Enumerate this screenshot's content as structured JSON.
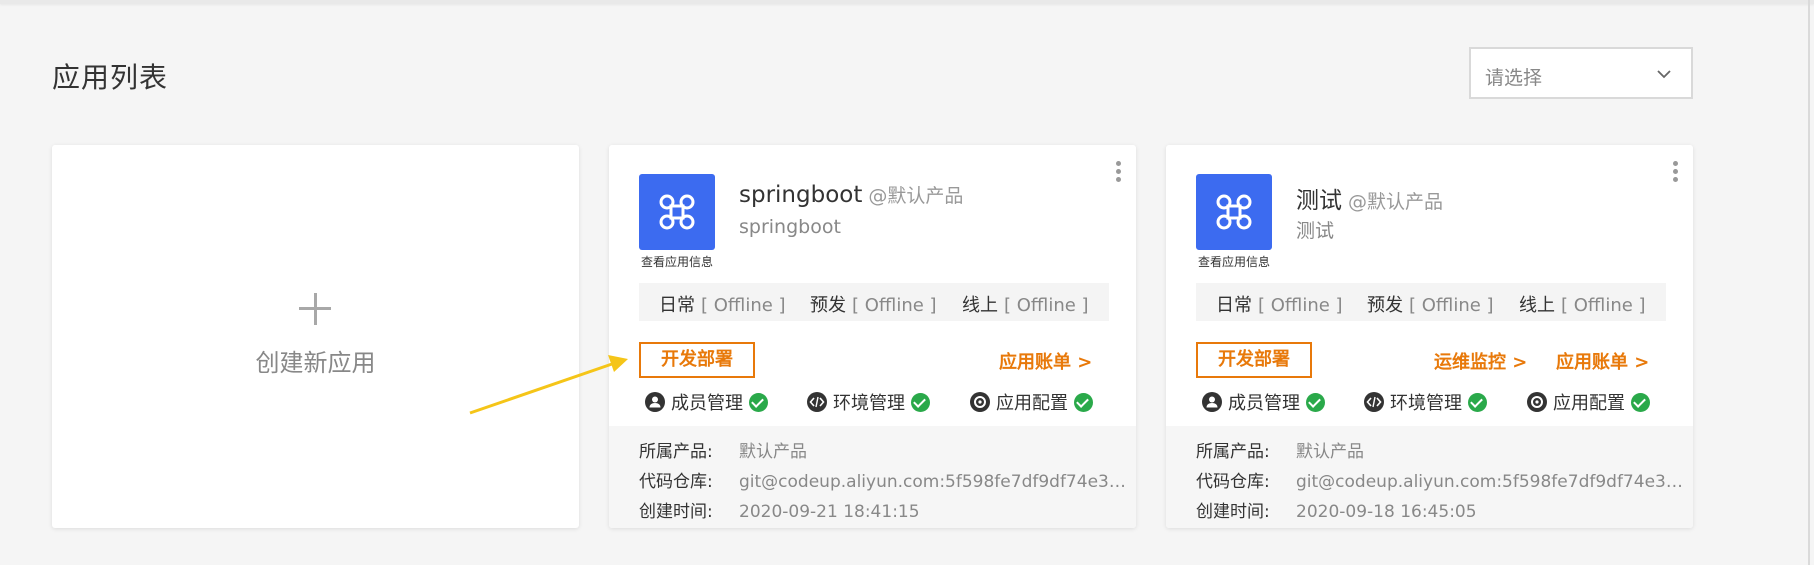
{
  "page": {
    "title": "应用列表"
  },
  "filter": {
    "placeholder": "请选择"
  },
  "create_card": {
    "label": "创建新应用"
  },
  "apps": [
    {
      "name": "springboot",
      "product_tag": "@默认产品",
      "description": "springboot",
      "view_info": "查看应用信息",
      "envs": [
        {
          "name": "日常",
          "status": "[ Offline ]"
        },
        {
          "name": "预发",
          "status": "[ Offline ]"
        },
        {
          "name": "线上",
          "status": "[ Offline ]"
        }
      ],
      "deploy_label": "开发部署",
      "links": [
        "应用账单 >"
      ],
      "features": [
        "成员管理",
        "环境管理",
        "应用配置"
      ],
      "meta": [
        {
          "key": "所属产品:",
          "value": "默认产品"
        },
        {
          "key": "代码仓库:",
          "value": "git@codeup.aliyun.com:5f598fe7df9df74e36b0..."
        },
        {
          "key": "创建时间:",
          "value": "2020-09-21 18:41:15"
        }
      ]
    },
    {
      "name": "测试",
      "product_tag": "@默认产品",
      "description": "测试",
      "view_info": "查看应用信息",
      "envs": [
        {
          "name": "日常",
          "status": "[ Offline ]"
        },
        {
          "name": "预发",
          "status": "[ Offline ]"
        },
        {
          "name": "线上",
          "status": "[ Offline ]"
        }
      ],
      "deploy_label": "开发部署",
      "links": [
        "运维监控 >",
        "应用账单 >"
      ],
      "features": [
        "成员管理",
        "环境管理",
        "应用配置"
      ],
      "meta": [
        {
          "key": "所属产品:",
          "value": "默认产品"
        },
        {
          "key": "代码仓库:",
          "value": "git@codeup.aliyun.com:5f598fe7df9df74e36b0..."
        },
        {
          "key": "创建时间:",
          "value": "2020-09-18 16:45:05"
        }
      ]
    }
  ],
  "colors": {
    "accent_orange": "#e8790a",
    "app_icon_blue": "#3c6bf0",
    "status_green": "#2aa94a",
    "annotation_arrow": "#f5c518"
  },
  "icons": {
    "app_icon": "command-icon",
    "features": [
      "user-icon",
      "code-icon",
      "gear-icon"
    ],
    "check": "check-circle-icon",
    "more": "more-vertical-icon",
    "select_arrow": "chevron-down-icon"
  }
}
